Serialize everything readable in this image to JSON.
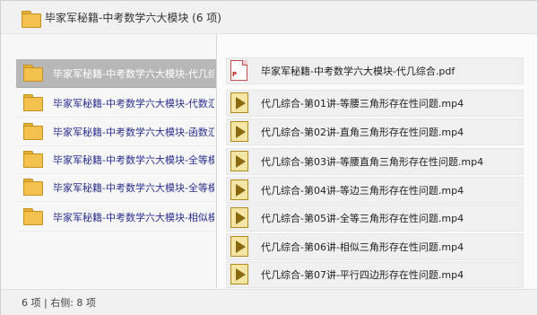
{
  "window": {
    "title": "毕家军秘籍-中考数学六大模块 (6 项)"
  },
  "left_panel": {
    "items": [
      {
        "label": "毕家军秘籍-中考数学六大模块-代几综合",
        "selected": true
      },
      {
        "label": "毕家军秘籍-中考数学六大模块-代数汇总",
        "selected": false
      },
      {
        "label": "毕家军秘籍-中考数学六大模块-函数汇总",
        "selected": false
      },
      {
        "label": "毕家军秘籍-中考数学六大模块-全等模型",
        "selected": false
      },
      {
        "label": "毕家军秘籍-中考数学六大模块-全等模型",
        "selected": false
      },
      {
        "label": "毕家军秘籍-中考数学六大模块-相似模型",
        "selected": false
      }
    ]
  },
  "right_panel": {
    "items": [
      {
        "label": "毕家军秘籍-中考数学六大模块-代几综合.pdf",
        "icon": "pdf-icon"
      },
      {
        "label": "代几综合-第01讲-等腰三角形存在性问题.mp4",
        "icon": "video-icon"
      },
      {
        "label": "代几综合-第02讲-直角三角形存在性问题.mp4",
        "icon": "video-icon"
      },
      {
        "label": "代几综合-第03讲-等腰直角三角形存在性问题.mp4",
        "icon": "video-icon"
      },
      {
        "label": "代几综合-第04讲-等边三角形存在性问题.mp4",
        "icon": "video-icon"
      },
      {
        "label": "代几综合-第05讲-全等三角形存在性问题.mp4",
        "icon": "video-icon"
      },
      {
        "label": "代几综合-第06讲-相似三角形存在性问题.mp4",
        "icon": "video-icon"
      },
      {
        "label": "代几综合-第07讲-平行四边形存在性问题.mp4",
        "icon": "video-icon"
      }
    ]
  },
  "status_bar": {
    "text": "6 项 | 右侧: 8 项"
  },
  "colors": {
    "folder": "#f3c24e",
    "selected_row": "#b7b7b7",
    "link_text": "#2b2f8c"
  }
}
